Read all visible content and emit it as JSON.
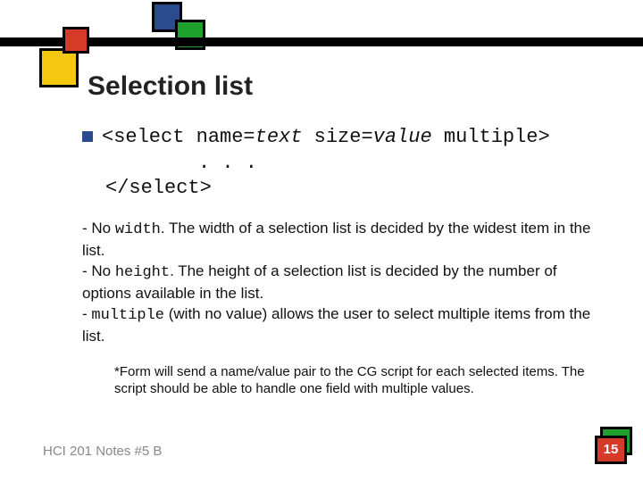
{
  "decoration": {
    "top_blue": {
      "color": "#2a4b8d"
    },
    "top_green": {
      "color": "#1fa12e"
    },
    "left_yellow": {
      "color": "#f4c80f"
    },
    "left_red": {
      "color": "#d63b2a"
    }
  },
  "title": "Selection list",
  "code": {
    "open_tag_prefix": "<select name=",
    "open_tag_text_var": "text",
    "open_tag_mid": " size=",
    "open_tag_value_var": "value",
    "open_tag_suffix": " multiple>",
    "ellipsis": ". . .",
    "close_tag": "</select>"
  },
  "body": {
    "line1_prefix": "- No ",
    "line1_code": "width",
    "line1_rest": ". The width of a selection list is decided by the widest item in the list.",
    "line2_prefix": "- No ",
    "line2_code": "height",
    "line2_rest": ". The height of a selection list is decided by the number of options available in the list.",
    "line3_prefix": "- ",
    "line3_code": "multiple",
    "line3_rest": " (with no value) allows the user to select multiple items from the list."
  },
  "note": "*Form will send a name/value pair to the CG script for each selected items. The script should be able to handle one field with multiple values.",
  "footer": "HCI 201 Notes #5 B",
  "page_number": "15"
}
